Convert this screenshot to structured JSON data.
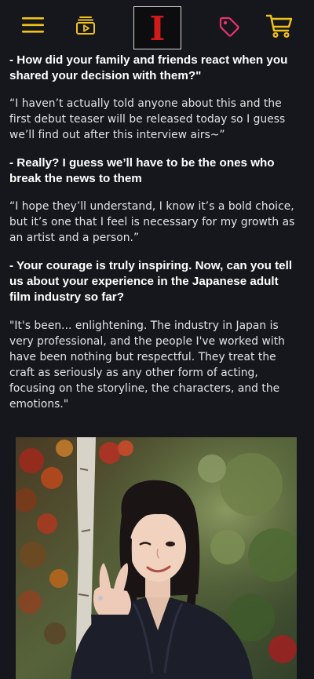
{
  "header": {
    "logo_text": "I",
    "menu_icon": "hamburger-menu-icon",
    "video_icon": "video-play-icon",
    "tag_icon": "tag-icon",
    "cart_icon": "shopping-cart-icon",
    "accent_color": "#f2c21b",
    "tag_color": "#e8326f",
    "logo_color": "#d11a1a"
  },
  "article": {
    "items": [
      {
        "question": "- How did your family and friends react when you shared your decision with them?\"",
        "answer": "“I haven’t actually told anyone about this and the first debut teaser will be released today so I guess we’ll find out after this interview airs~”"
      },
      {
        "question": "- Really? I guess we’ll have to be the ones who break the news to them",
        "answer": "“I hope they’ll understand, I know it’s a bold choice, but it’s one that I feel is necessary for my growth as an artist and a person.”"
      },
      {
        "question": "- Your courage is truly inspiring. Now, can you tell us about your experience in the Japanese adult film industry so far?",
        "answer": "\"It's been... enlightening. The industry in Japan is very professional, and the people I've worked with have been nothing but respectful. They treat the craft as seriously as any other form of acting, focusing on the storyline, the characters, and the emotions.\""
      }
    ]
  }
}
